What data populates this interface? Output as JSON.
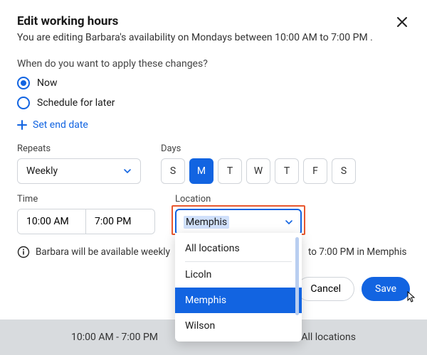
{
  "modal": {
    "title": "Edit working hours",
    "subtitle": "You are editing Barbara's availability on Mondays between 10:00 AM to 7:00 PM .",
    "question": "When do you want to apply these changes?",
    "options": {
      "now": "Now",
      "later": "Schedule for later"
    },
    "set_end_date": "Set end date",
    "repeats_label": "Repeats",
    "repeats_value": "Weekly",
    "days_label": "Days",
    "days": [
      "S",
      "M",
      "T",
      "W",
      "T",
      "F",
      "S"
    ],
    "selected_day_index": 1,
    "time_label": "Time",
    "time_start": "10:00 AM",
    "time_end": "7:00 PM",
    "location_label": "Location",
    "location_value": "Memphis",
    "location_options": [
      "All locations",
      "Licoln",
      "Memphis",
      "Wilson"
    ],
    "info_text": "Barbara will be available weekly",
    "info_text_tail": "to 7:00 PM in Memphis",
    "cancel": "Cancel",
    "save": "Save"
  },
  "footer": {
    "time_range": "10:00 AM - 7:00 PM",
    "loc": "All locations"
  }
}
